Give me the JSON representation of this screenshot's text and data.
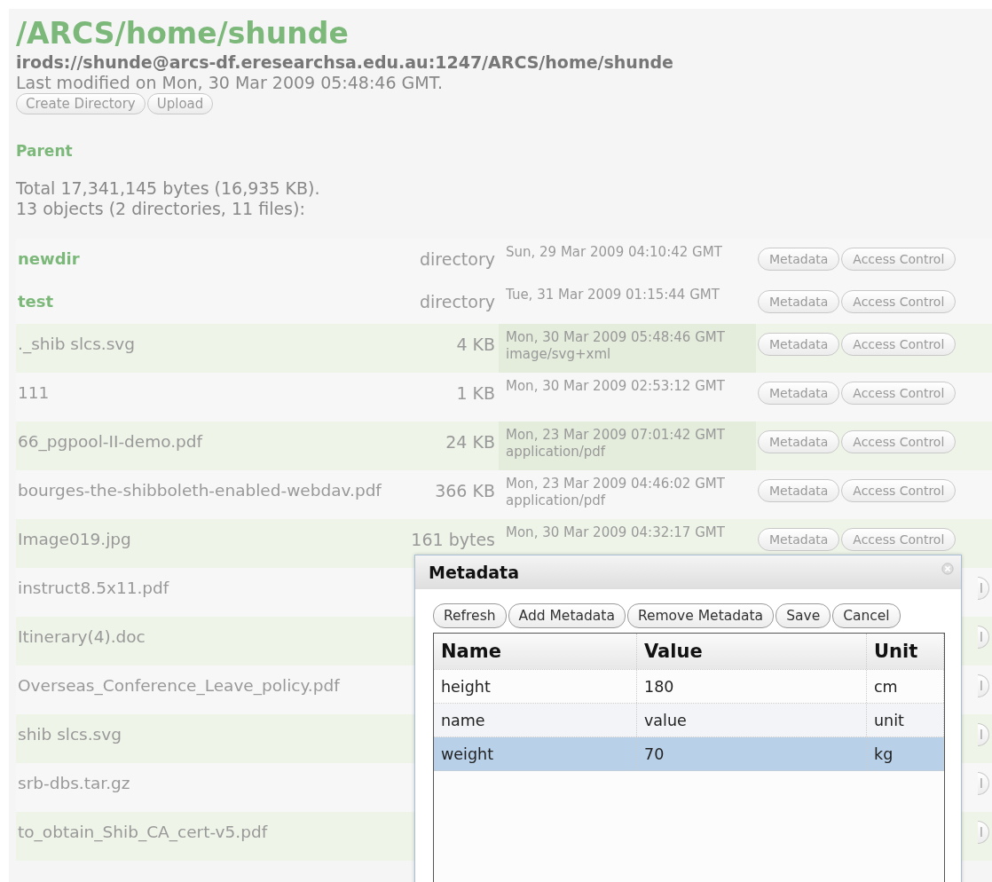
{
  "header": {
    "title": "/ARCS/home/shunde",
    "url": "irods://shunde@arcs-df.eresearchsa.edu.au:1247/ARCS/home/shunde",
    "modified": "Last modified on Mon, 30 Mar 2009 05:48:46 GMT.",
    "buttons": [
      "Create Directory",
      "Upload"
    ]
  },
  "parent_link": "Parent",
  "summary": [
    "Total 17,341,145 bytes (16,935 KB).",
    "13 objects (2 directories, 11 files):"
  ],
  "rows": [
    {
      "kind": "directory",
      "name": "newdir",
      "size": "directory",
      "date": "Sun, 29 Mar 2009 04:10:42 GMT",
      "buttons": [
        "Metadata",
        "Access Control"
      ]
    },
    {
      "kind": "directory",
      "name": "test",
      "size": "directory",
      "date": "Tue, 31 Mar 2009 01:15:44 GMT",
      "buttons": [
        "Metadata",
        "Access Control"
      ]
    },
    {
      "kind": "file",
      "name": "._shib slcs.svg",
      "size": "4 KB",
      "date": "Mon, 30 Mar 2009 05:48:46 GMT",
      "mime": "image/svg+xml",
      "buttons": [
        "Metadata",
        "Access Control"
      ]
    },
    {
      "kind": "file",
      "name": "111",
      "size": "1 KB",
      "date": "Mon, 30 Mar 2009 02:53:12 GMT",
      "buttons": [
        "Metadata",
        "Access Control"
      ]
    },
    {
      "kind": "file",
      "name": "66_pgpool-II-demo.pdf",
      "size": "24 KB",
      "date": "Mon, 23 Mar 2009 07:01:42 GMT",
      "mime": "application/pdf",
      "buttons": [
        "Metadata",
        "Access Control"
      ]
    },
    {
      "kind": "file",
      "name": "bourges-the-shibboleth-enabled-webdav.pdf",
      "size": "366 KB",
      "date": "Mon, 23 Mar 2009 04:46:02 GMT",
      "mime": "application/pdf",
      "buttons": [
        "Metadata",
        "Access Control"
      ]
    },
    {
      "kind": "file",
      "name": "Image019.jpg",
      "size": "161 bytes",
      "date": "Mon, 30 Mar 2009 04:32:17 GMT",
      "buttons": [
        "Metadata",
        "Access Control"
      ]
    },
    {
      "kind": "file",
      "name": "instruct8.5x11.pdf",
      "button_edge": "l"
    },
    {
      "kind": "file",
      "name": "Itinerary(4).doc",
      "button_edge": "l"
    },
    {
      "kind": "file",
      "name": "Overseas_Conference_Leave_policy.pdf",
      "button_edge": "l"
    },
    {
      "kind": "file",
      "name": "shib slcs.svg",
      "button_edge": "l"
    },
    {
      "kind": "file",
      "name": "srb-dbs.tar.gz",
      "button_edge": "l"
    },
    {
      "kind": "file",
      "name": "to_obtain_Shib_CA_cert-v5.pdf",
      "button_edge": "l"
    }
  ],
  "dialog": {
    "title": "Metadata",
    "buttons": [
      "Refresh",
      "Add Metadata",
      "Remove Metadata",
      "Save",
      "Cancel"
    ],
    "table": {
      "columns": [
        "Name",
        "Value",
        "Unit"
      ],
      "rows": [
        {
          "cells": [
            "height",
            "180",
            "cm"
          ],
          "selected": false
        },
        {
          "cells": [
            "name",
            "value",
            "unit"
          ],
          "selected": false
        },
        {
          "cells": [
            "weight",
            "70",
            "kg"
          ],
          "selected": true
        }
      ]
    }
  }
}
